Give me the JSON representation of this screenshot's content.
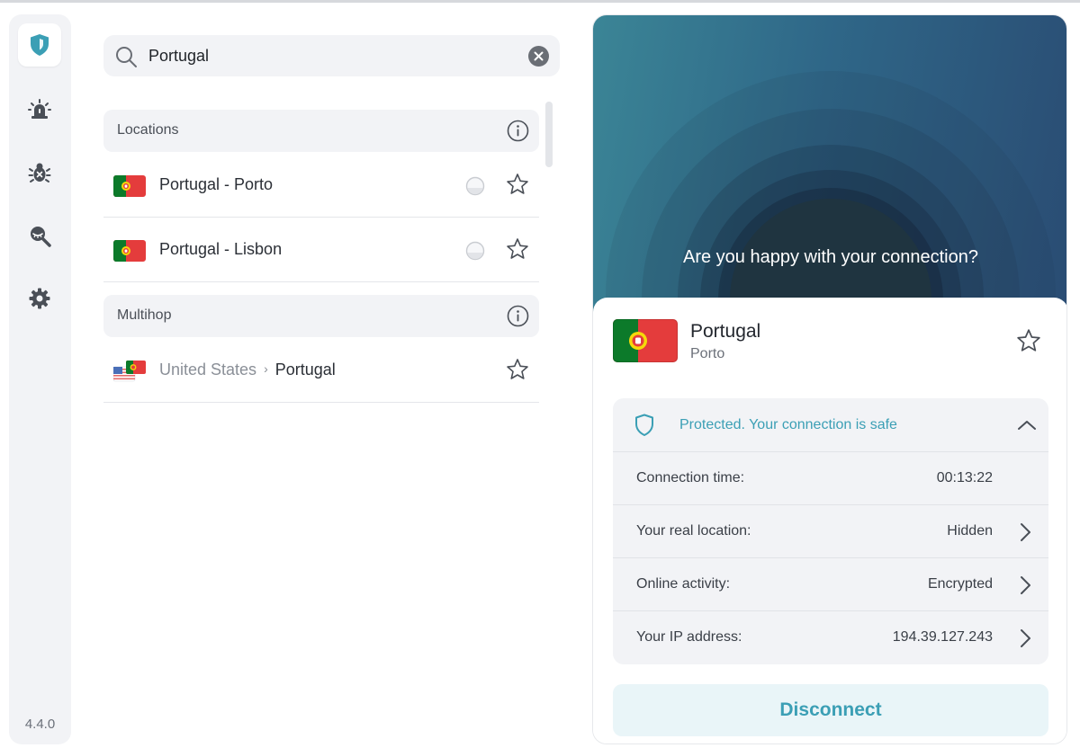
{
  "app": {
    "version": "4.4.0"
  },
  "sidebar": {
    "items": [
      {
        "name": "shield-icon",
        "active": true
      },
      {
        "name": "alarm-icon",
        "active": false
      },
      {
        "name": "bug-icon",
        "active": false
      },
      {
        "name": "search-eye-icon",
        "active": false
      },
      {
        "name": "gear-icon",
        "active": false
      }
    ]
  },
  "search": {
    "value": "Portugal",
    "placeholder": ""
  },
  "list": {
    "locations": {
      "header": "Locations",
      "items": [
        {
          "label": "Portugal - Porto",
          "flag": "portugal"
        },
        {
          "label": "Portugal - Lisbon",
          "flag": "portugal"
        }
      ]
    },
    "multihop": {
      "header": "Multihop",
      "items": [
        {
          "from": "United States",
          "to": "Portugal"
        }
      ]
    }
  },
  "connection": {
    "question": "Are you happy with your connection?",
    "country": "Portugal",
    "city": "Porto",
    "status": "Protected. Your connection is safe",
    "details": [
      {
        "label": "Connection time:",
        "value": "00:13:22"
      },
      {
        "label": "Your real location:",
        "value": "Hidden"
      },
      {
        "label": "Online activity:",
        "value": "Encrypted"
      },
      {
        "label": "Your IP address:",
        "value": "194.39.127.243"
      }
    ],
    "disconnect_label": "Disconnect"
  },
  "colors": {
    "accent": "#3b9fb5",
    "sidebar_bg": "#f2f3f6",
    "hero_start": "#3b8596",
    "hero_end": "#2a4c73",
    "flag_green": "#0c7a2a",
    "flag_red": "#e43c3c"
  }
}
